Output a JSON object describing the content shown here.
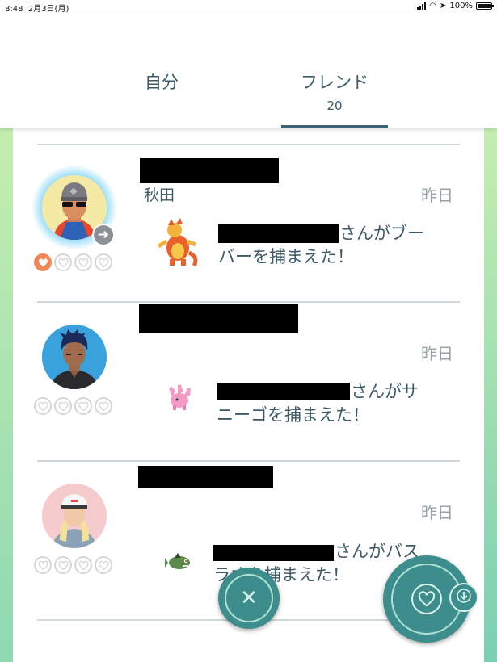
{
  "status_bar": {
    "time": "8:48",
    "date": "2月3日(月)",
    "battery": "100%"
  },
  "tabs": {
    "self_label": "自分",
    "friends_label": "フレンド",
    "friends_count": "20",
    "active": "friends"
  },
  "friends": [
    {
      "city": "秋田",
      "date": "昨日",
      "message_suffix": "さんがブー",
      "message_line2": "バーを捕まえた！",
      "pokemon_icon": "magmar-icon",
      "hearts_filled": 1,
      "hearts_total": 4
    },
    {
      "city": "",
      "date": "昨日",
      "message_suffix": "さんがサ",
      "message_line2": "ニーゴを捕まえた！",
      "pokemon_icon": "corsola-icon",
      "hearts_filled": 0,
      "hearts_total": 4
    },
    {
      "city": "",
      "date": "昨日",
      "message_suffix": "さんがバス",
      "message_line2": "ラオを捕まえた！",
      "pokemon_icon": "basculin-icon",
      "hearts_filled": 0,
      "hearts_total": 4
    }
  ],
  "colors": {
    "accent": "#3d8d8c",
    "heart_filled": "#ef8a58",
    "text": "#3d5a66"
  },
  "icons": {
    "close": "close-icon",
    "gift_heart": "heart-icon",
    "sort": "sort-down-icon"
  }
}
